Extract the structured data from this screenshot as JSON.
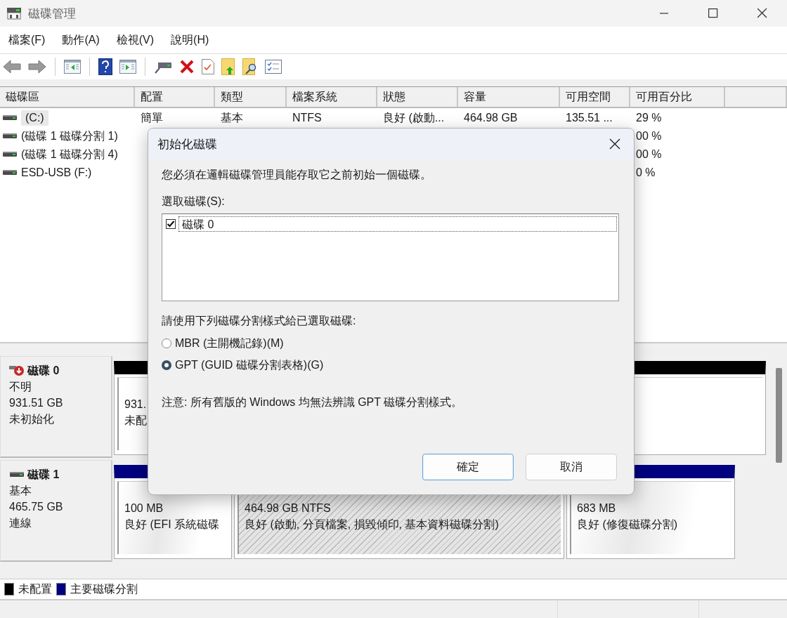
{
  "window": {
    "title": "磁碟管理"
  },
  "menu": [
    {
      "label": "檔案(F)"
    },
    {
      "label": "動作(A)"
    },
    {
      "label": "檢視(V)"
    },
    {
      "label": "說明(H)"
    }
  ],
  "volumes": {
    "columns": [
      "磁碟區",
      "配置",
      "類型",
      "檔案系統",
      "狀態",
      "容量",
      "可用空間",
      "可用百分比"
    ],
    "rows": [
      {
        "selected": true,
        "cells": [
          "(C:)",
          "簡單",
          "基本",
          "NTFS",
          "良好 (啟動...",
          "464.98 GB",
          "135.51 ...",
          "29 %"
        ]
      },
      {
        "selected": false,
        "cells": [
          "(磁碟 1 磁碟分割 1)",
          null,
          null,
          null,
          null,
          null,
          null,
          "00 %"
        ]
      },
      {
        "selected": false,
        "cells": [
          "(磁碟 1 磁碟分割 4)",
          null,
          null,
          null,
          null,
          null,
          null,
          "00 %"
        ]
      },
      {
        "selected": false,
        "cells": [
          "ESD-USB (F:)",
          null,
          null,
          null,
          null,
          null,
          null,
          "0 %"
        ]
      }
    ]
  },
  "disks": [
    {
      "name": "磁碟 0",
      "kind": "uninitialized",
      "type": "不明",
      "size": "931.51 GB",
      "status": "未初始化",
      "partitions": [
        {
          "kind": "unallocated",
          "selected": false,
          "lines": [
            "931.",
            "未配"
          ]
        }
      ]
    },
    {
      "name": "磁碟 1",
      "kind": "online",
      "type": "基本",
      "size": "465.75 GB",
      "status": "連線",
      "partitions": [
        {
          "kind": "primary",
          "selected": false,
          "lines": [
            "100 MB",
            "良好 (EFI 系統磁碟"
          ]
        },
        {
          "kind": "primary",
          "selected": true,
          "lines": [
            "464.98 GB NTFS",
            "良好 (啟動, 分頁檔案, 損毀傾印, 基本資料磁碟分割)"
          ]
        },
        {
          "kind": "primary",
          "selected": false,
          "lines": [
            "683 MB",
            "良好 (修復磁碟分割)"
          ]
        }
      ]
    }
  ],
  "legend": [
    {
      "label": "未配置",
      "color": "#000000"
    },
    {
      "label": "主要磁碟分割",
      "color": "#000080"
    }
  ],
  "dialog": {
    "title": "初始化磁碟",
    "message": "您必須在邏輯磁碟管理員能存取它之前初始一個磁碟。",
    "select_label": "選取磁碟(S):",
    "disks": [
      {
        "label": "磁碟 0",
        "checked": true,
        "selected": true
      }
    ],
    "style_label": "請使用下列磁碟分割樣式給已選取磁碟:",
    "styles": [
      {
        "label": "MBR (主開機記錄)(M)",
        "selected": false
      },
      {
        "label": "GPT (GUID 磁碟分割表格)(G)",
        "selected": true
      }
    ],
    "note": "注意: 所有舊版的 Windows 均無法辨識 GPT 磁碟分割樣式。",
    "buttons": [
      {
        "label": "確定",
        "default": true
      },
      {
        "label": "取消",
        "default": false
      }
    ]
  }
}
